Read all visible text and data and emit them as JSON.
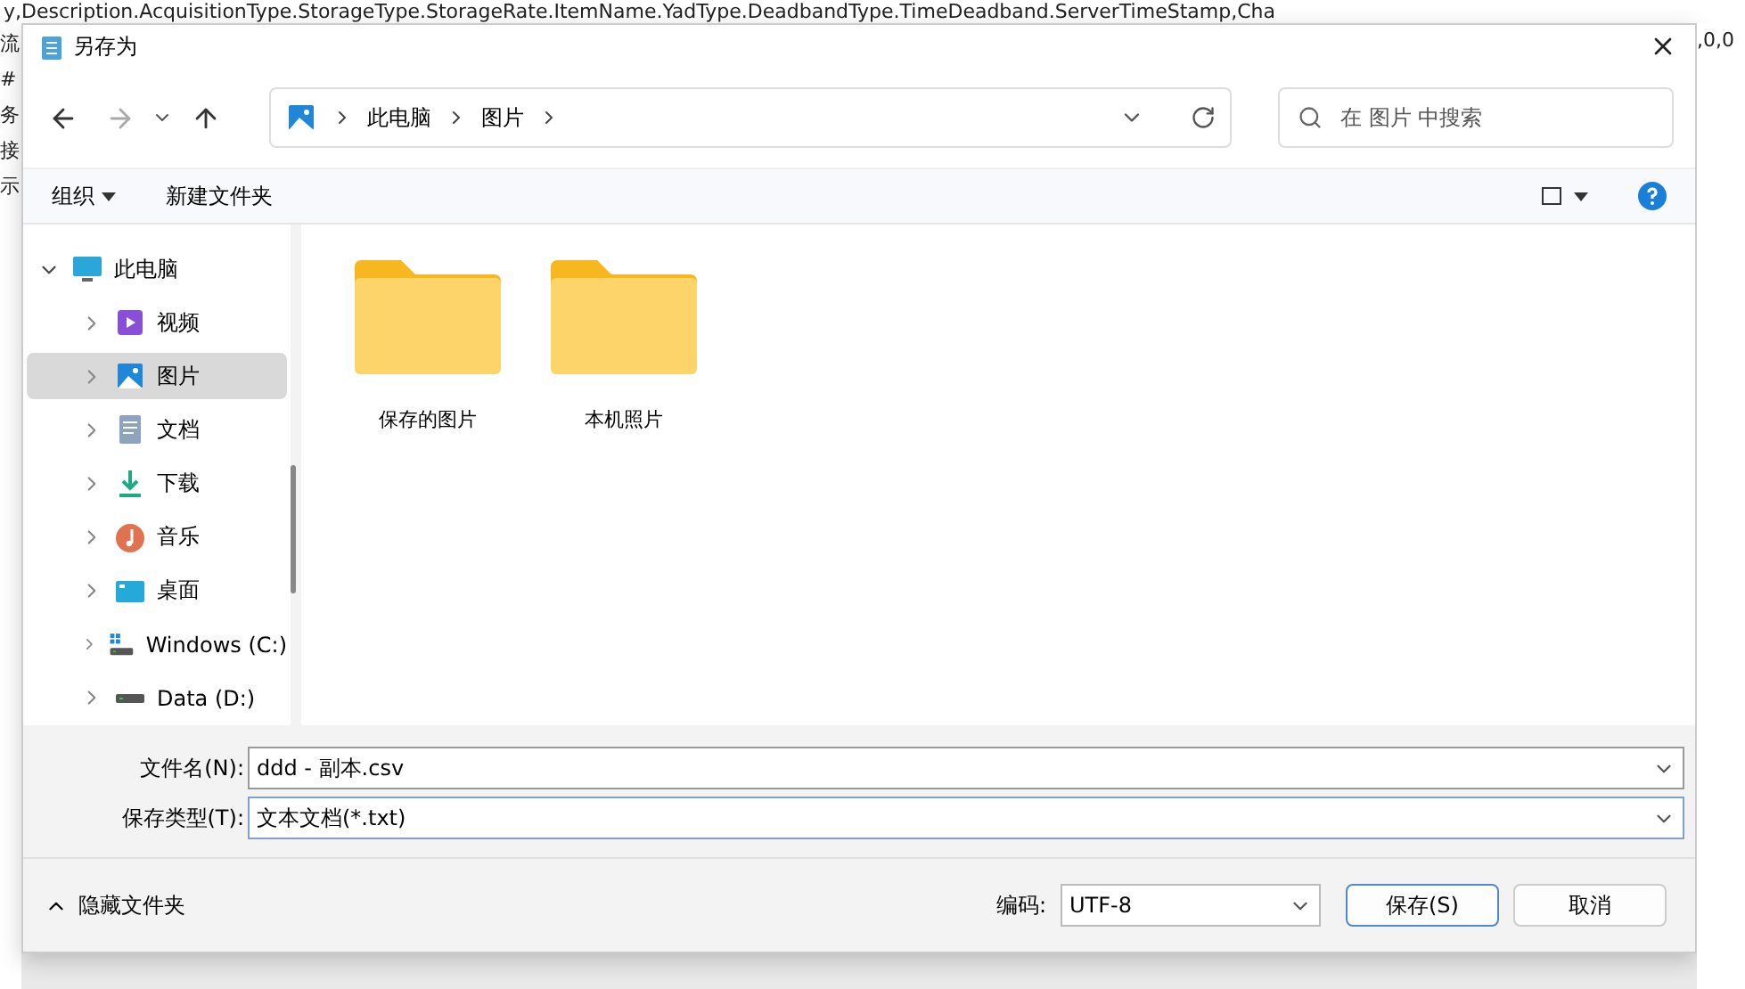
{
  "background": {
    "top_line": "y,Description.AcquisitionType.StorageType.StorageRate.ItemName.YadType.DeadbandType.TimeDeadband.ServerTimeStamp,Cha",
    "left_fragments": [
      "流",
      "#",
      "务",
      "接",
      "示"
    ],
    "right_fragment": ",0,0"
  },
  "dialog": {
    "title": "另存为",
    "address": [
      "此电脑",
      "图片"
    ],
    "search": {
      "placeholder": "在 图片 中搜索"
    },
    "toolbar": {
      "organize": "组织",
      "new_folder": "新建文件夹"
    },
    "sidebar": [
      {
        "label": "此电脑",
        "kind": "computer",
        "expanded": true,
        "selected": false,
        "children": [
          {
            "label": "视频",
            "kind": "video",
            "expanded": false,
            "selected": false
          },
          {
            "label": "图片",
            "kind": "pictures",
            "expanded": false,
            "selected": true
          },
          {
            "label": "文档",
            "kind": "documents",
            "expanded": false,
            "selected": false
          },
          {
            "label": "下载",
            "kind": "downloads",
            "expanded": false,
            "selected": false
          },
          {
            "label": "音乐",
            "kind": "music",
            "expanded": false,
            "selected": false
          },
          {
            "label": "桌面",
            "kind": "desktop",
            "expanded": false,
            "selected": false
          },
          {
            "label": "Windows (C:)",
            "kind": "system-drive",
            "expanded": false,
            "selected": false
          },
          {
            "label": "Data (D:)",
            "kind": "drive",
            "expanded": false,
            "selected": false
          }
        ]
      }
    ],
    "folders": [
      "保存的图片",
      "本机照片"
    ],
    "filename": {
      "label": "文件名(N):",
      "value": "ddd - 副本.csv"
    },
    "filetype": {
      "label": "保存类型(T):",
      "value": "文本文档(*.txt)"
    },
    "hide_folders": "隐藏文件夹",
    "encoding": {
      "label": "编码:",
      "value": "UTF-8"
    },
    "buttons": {
      "save": "保存(S)",
      "cancel": "取消"
    }
  }
}
